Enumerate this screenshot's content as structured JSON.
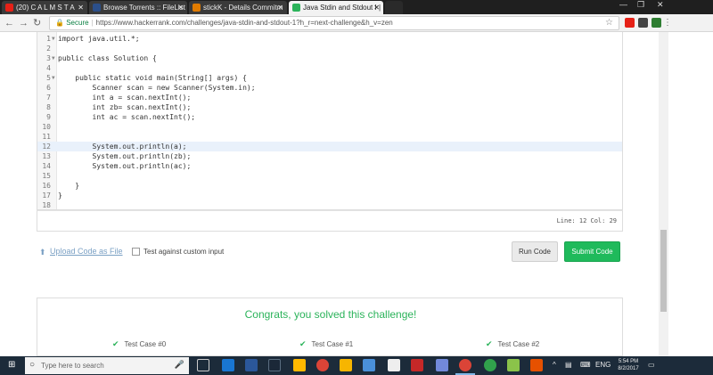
{
  "browser": {
    "tabs": [
      {
        "label": "(20) C A L M   S T A",
        "active": false,
        "favicon_color": "#e62117"
      },
      {
        "label": "Browse Torrents :: FileList",
        "active": false,
        "favicon_color": "#2b4f8a"
      },
      {
        "label": "stickK - Details Commitm",
        "active": false,
        "favicon_color": "#e07b00"
      },
      {
        "label": "Java Stdin and Stdout I |",
        "active": true,
        "favicon_color": "#2bb35a"
      }
    ],
    "secure_label": "Secure",
    "url": "https://www.hackerrank.com/challenges/java-stdin-and-stdout-1?h_r=next-challenge&h_v=zen"
  },
  "editor": {
    "lines": [
      {
        "n": "1",
        "text": "import java.util.*;",
        "fold": true
      },
      {
        "n": "2",
        "text": ""
      },
      {
        "n": "3",
        "text": "public class Solution {",
        "fold": true
      },
      {
        "n": "4",
        "text": ""
      },
      {
        "n": "5",
        "text": "    public static void main(String[] args) {",
        "fold": true
      },
      {
        "n": "6",
        "text": "        Scanner scan = new Scanner(System.in);"
      },
      {
        "n": "7",
        "text": "        int a = scan.nextInt();"
      },
      {
        "n": "8",
        "text": "        int zb= scan.nextInt();"
      },
      {
        "n": "9",
        "text": "        int ac = scan.nextInt();"
      },
      {
        "n": "10",
        "text": ""
      },
      {
        "n": "11",
        "text": ""
      },
      {
        "n": "12",
        "text": "        System.out.println(a);",
        "highlight": true
      },
      {
        "n": "13",
        "text": "        System.out.println(zb);"
      },
      {
        "n": "14",
        "text": "        System.out.println(ac);"
      },
      {
        "n": "15",
        "text": ""
      },
      {
        "n": "16",
        "text": "    }"
      },
      {
        "n": "17",
        "text": "}"
      },
      {
        "n": "18",
        "text": ""
      }
    ],
    "status": "Line: 12 Col: 29"
  },
  "actions": {
    "upload_label": "Upload Code as File",
    "custom_input_label": "Test against custom input",
    "run_label": "Run Code",
    "submit_label": "Submit Code"
  },
  "result": {
    "message": "Congrats, you solved this challenge!",
    "test_cases": [
      "Test Case #0",
      "Test Case #1",
      "Test Case #2"
    ]
  },
  "taskbar": {
    "search_placeholder": "Type here to search",
    "lang": "ENG",
    "time": "5:54 PM",
    "date": "8/2/2017"
  },
  "colors": {
    "accent_green": "#2bb35a",
    "submit_green": "#1fba5b",
    "link_blue": "#7aa0c4"
  }
}
